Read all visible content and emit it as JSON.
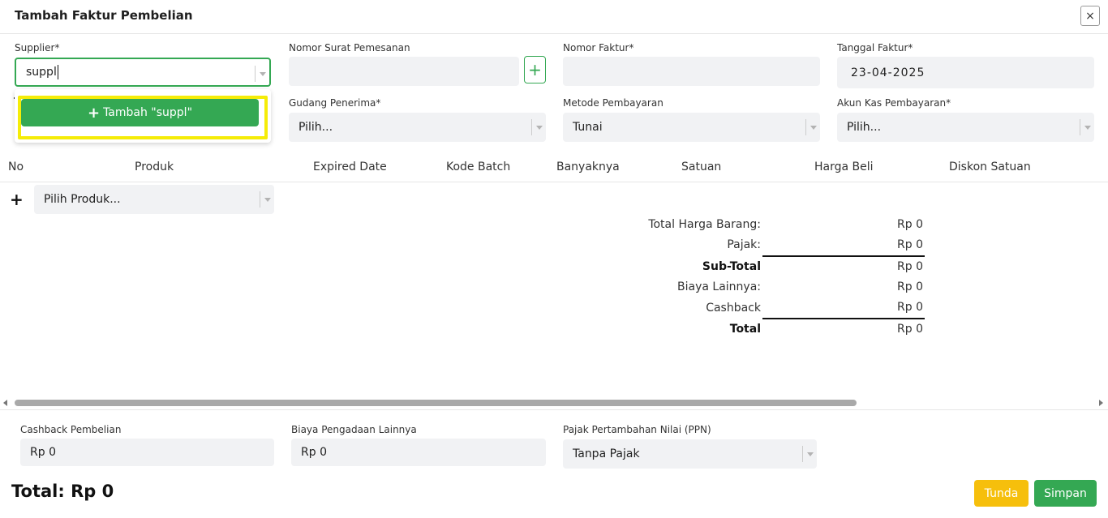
{
  "header": {
    "title": "Tambah Faktur Pembelian",
    "close_icon": "×"
  },
  "form": {
    "supplier": {
      "label": "Supplier*",
      "value": "suppl"
    },
    "nomor_surat": {
      "label": "Nomor Surat Pemesanan",
      "value": ""
    },
    "add_button_icon": "+",
    "nomor_faktur": {
      "label": "Nomor Faktur*",
      "value": ""
    },
    "tanggal_faktur": {
      "label": "Tanggal Faktur*",
      "value": "23-04-2025"
    },
    "gudang": {
      "label": "Gudang Penerima*",
      "value": "Pilih..."
    },
    "metode": {
      "label": "Metode Pembayaran",
      "value": "Tunai"
    },
    "akun_kas": {
      "label": "Akun Kas Pembayaran*",
      "value": "Pilih..."
    }
  },
  "dropdown": {
    "icon": "+",
    "add_label": "Tambah \"suppl\""
  },
  "table": {
    "columns": [
      "No",
      "Produk",
      "Expired Date",
      "Kode Batch",
      "Banyaknya",
      "Satuan",
      "Harga Beli",
      "Diskon Satuan"
    ],
    "add_row_icon": "+",
    "product_placeholder": "Pilih Produk..."
  },
  "summary": [
    {
      "label": "Total Harga Barang:",
      "value": "Rp 0"
    },
    {
      "label": "Pajak:",
      "value": "Rp 0"
    },
    {
      "label": "Sub-Total",
      "value": "Rp 0"
    },
    {
      "label": "Biaya Lainnya:",
      "value": "Rp 0"
    },
    {
      "label": "Cashback",
      "value": "Rp 0"
    },
    {
      "label": "Total",
      "value": "Rp 0"
    }
  ],
  "bottom": {
    "cashback": {
      "label": "Cashback Pembelian",
      "value": "Rp 0"
    },
    "biaya": {
      "label": "Biaya Pengadaan Lainnya",
      "value": "Rp 0"
    },
    "ppn": {
      "label": "Pajak Pertambahan Nilai (PPN)",
      "value": "Tanpa Pajak"
    }
  },
  "footer": {
    "total": "Total: Rp 0",
    "tunda_label": "Tunda",
    "simpan_label": "Simpan"
  },
  "colors": {
    "primary": "#34a853",
    "warning": "#f6bf0c",
    "highlight": "#f5ec07"
  }
}
